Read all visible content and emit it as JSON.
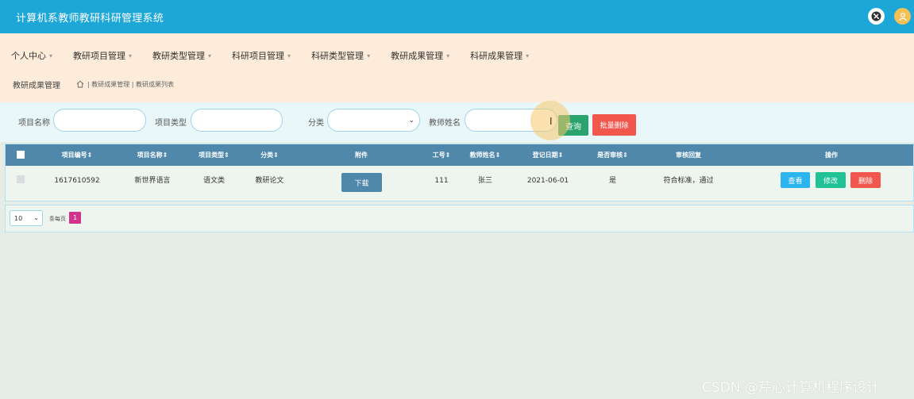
{
  "app": {
    "title": "计算机系教师教研科研管理系统"
  },
  "header": {
    "tools_icon": "tools-icon",
    "user_icon": "user-avatar-icon",
    "accent": "#1ca7d8"
  },
  "nav": {
    "items": [
      {
        "label": "个人中心"
      },
      {
        "label": "教研项目管理"
      },
      {
        "label": "教研类型管理"
      },
      {
        "label": "科研项目管理"
      },
      {
        "label": "科研类型管理"
      },
      {
        "label": "教研成果管理"
      },
      {
        "label": "科研成果管理"
      }
    ],
    "caret": "▾"
  },
  "breadcrumb": {
    "section": "教研成果管理",
    "path": "| 教研成果管理 | 教研成果列表",
    "home_icon": "home-icon"
  },
  "search": {
    "project_name_label": "项目名称",
    "project_type_label": "项目类型",
    "category_label": "分类",
    "teacher_name_label": "教师姓名",
    "query_button": "查询",
    "batch_delete_button": "批量删除",
    "select_arrow": "⌄"
  },
  "table": {
    "headers": [
      "项目编号⇕",
      "项目名称⇕",
      "项目类型⇕",
      "分类⇕",
      "附件",
      "工号⇕",
      "教师姓名⇕",
      "登记日期⇕",
      "是否审核⇕",
      "审核回复",
      "操作"
    ],
    "rows": [
      {
        "project_no": "1617610592",
        "project_name": "新世界语言",
        "project_type": "语文类",
        "category": "教研论文",
        "attachment_button": "下载",
        "staff_no": "111",
        "teacher_name": "张三",
        "date": "2021-06-01",
        "audited": "是",
        "reply": "符合标准，通过",
        "view_button": "查看",
        "edit_button": "修改",
        "delete_button": "删除"
      }
    ]
  },
  "pagination": {
    "page_size": "10",
    "arrow": "⌄",
    "per_page_label": "条每页",
    "current_page": "1"
  },
  "watermark": "CSDN @芹心计算机程序设计",
  "cursor": "I"
}
